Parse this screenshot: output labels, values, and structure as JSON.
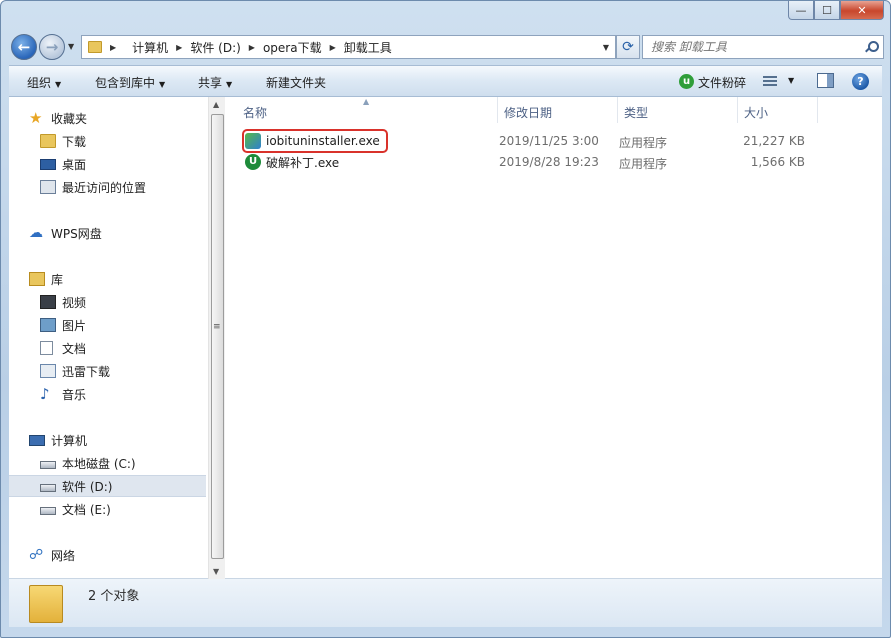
{
  "window": {
    "caption_min": "—",
    "caption_max": "☐",
    "caption_close": "✕"
  },
  "address": {
    "crumbs": [
      "计算机",
      "软件 (D:)",
      "opera下载",
      "卸载工具"
    ]
  },
  "search": {
    "placeholder": "搜索 卸载工具"
  },
  "toolbar": {
    "organize": "组织",
    "include_in_library": "包含到库中",
    "share": "共享",
    "new_folder": "新建文件夹",
    "shred": "文件粉碎"
  },
  "sidebar": {
    "items": [
      {
        "label": "收藏夹",
        "icon": "star-icon"
      },
      {
        "label": "下载",
        "icon": "download-folder-icon"
      },
      {
        "label": "桌面",
        "icon": "desktop-icon"
      },
      {
        "label": "最近访问的位置",
        "icon": "recent-places-icon"
      },
      {
        "label": "WPS网盘",
        "icon": "cloud-icon"
      },
      {
        "label": "库",
        "icon": "library-icon"
      },
      {
        "label": "视频",
        "icon": "video-icon"
      },
      {
        "label": "图片",
        "icon": "picture-icon"
      },
      {
        "label": "文档",
        "icon": "document-icon"
      },
      {
        "label": "迅雷下载",
        "icon": "xunlei-icon"
      },
      {
        "label": "音乐",
        "icon": "music-icon"
      },
      {
        "label": "计算机",
        "icon": "computer-icon"
      },
      {
        "label": "本地磁盘 (C:)",
        "icon": "drive-icon"
      },
      {
        "label": "软件 (D:)",
        "icon": "drive-icon"
      },
      {
        "label": "文档 (E:)",
        "icon": "drive-icon"
      },
      {
        "label": "网络",
        "icon": "network-icon"
      }
    ]
  },
  "columns": {
    "name": "名称",
    "date": "修改日期",
    "type": "类型",
    "size": "大小"
  },
  "files": [
    {
      "name": "iobituninstaller.exe",
      "date": "2019/11/25 3:00",
      "type": "应用程序",
      "size": "21,227 KB",
      "highlighted": true
    },
    {
      "name": "破解补丁.exe",
      "date": "2019/8/28 19:23",
      "type": "应用程序",
      "size": "1,566 KB",
      "highlighted": false
    }
  ],
  "status": {
    "count": "2 个对象"
  },
  "colors": {
    "highlight_border": "#d9322b",
    "column_header_text": "#4d6185"
  }
}
